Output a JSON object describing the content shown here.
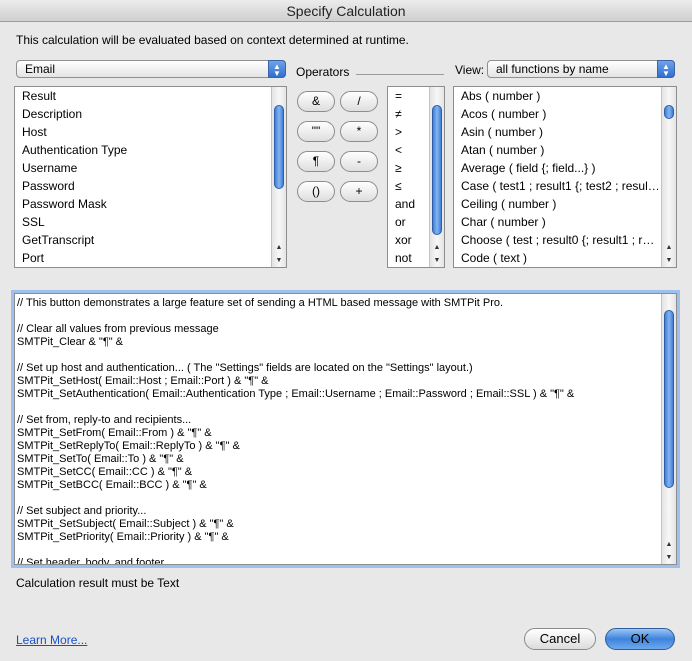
{
  "window": {
    "title": "Specify Calculation"
  },
  "description": "This calculation will be evaluated based on context determined at runtime.",
  "table_popup": {
    "value": "Email"
  },
  "operators_label": "Operators",
  "view": {
    "label": "View:",
    "value": "all functions by name"
  },
  "fields": [
    "Result",
    "Description",
    "Host",
    "Authentication Type",
    "Username",
    "Password",
    "Password Mask",
    "SSL",
    "GetTranscript",
    "Port"
  ],
  "operator_buttons": [
    "&",
    "/",
    "\"\"",
    "*",
    "¶",
    "-",
    "()",
    "+"
  ],
  "comparison_operators": [
    "=",
    "≠",
    ">",
    "<",
    "≥",
    "≤",
    "and",
    "or",
    "xor",
    "not"
  ],
  "functions": [
    "Abs ( number )",
    "Acos ( number )",
    "Asin ( number )",
    "Atan ( number )",
    "Average ( field {; field...} )",
    "Case ( test1 ; result1 {; test2 ; resul…",
    "Ceiling ( number )",
    "Char ( number )",
    "Choose ( test ; result0 {; result1 ; r…",
    "Code ( text )"
  ],
  "code_lines": [
    "// This button demonstrates a large feature set of sending a HTML based message with SMTPit Pro.",
    "",
    "// Clear all values from previous message",
    "SMTPit_Clear & \"¶\" &",
    "",
    "// Set up host and authentication... ( The \"Settings\" fields are located on the \"Settings\" layout.)",
    "SMTPit_SetHost( Email::Host ; Email::Port ) & \"¶\" &",
    "SMTPit_SetAuthentication( Email::Authentication Type ; Email::Username ; Email::Password ; Email::SSL ) & \"¶\" &",
    "",
    "// Set from, reply-to and recipients...",
    "SMTPit_SetFrom( Email::From ) & \"¶\" &",
    "SMTPit_SetReplyTo( Email::ReplyTo ) & \"¶\" &",
    "SMTPit_SetTo( Email::To ) & \"¶\" &",
    "SMTPit_SetCC( Email::CC ) & \"¶\" &",
    "SMTPit_SetBCC( Email::BCC ) & \"¶\" &",
    "",
    "// Set subject and priority...",
    "SMTPit_SetSubject( Email::Subject ) & \"¶\" &",
    "SMTPit_SetPriority( Email::Priority ) & \"¶\" &",
    "",
    "// Set header, body, and footer..."
  ],
  "result_type": "Calculation result must be Text",
  "learn_more": "Learn More...",
  "cancel_label": "Cancel",
  "ok_label": "OK"
}
